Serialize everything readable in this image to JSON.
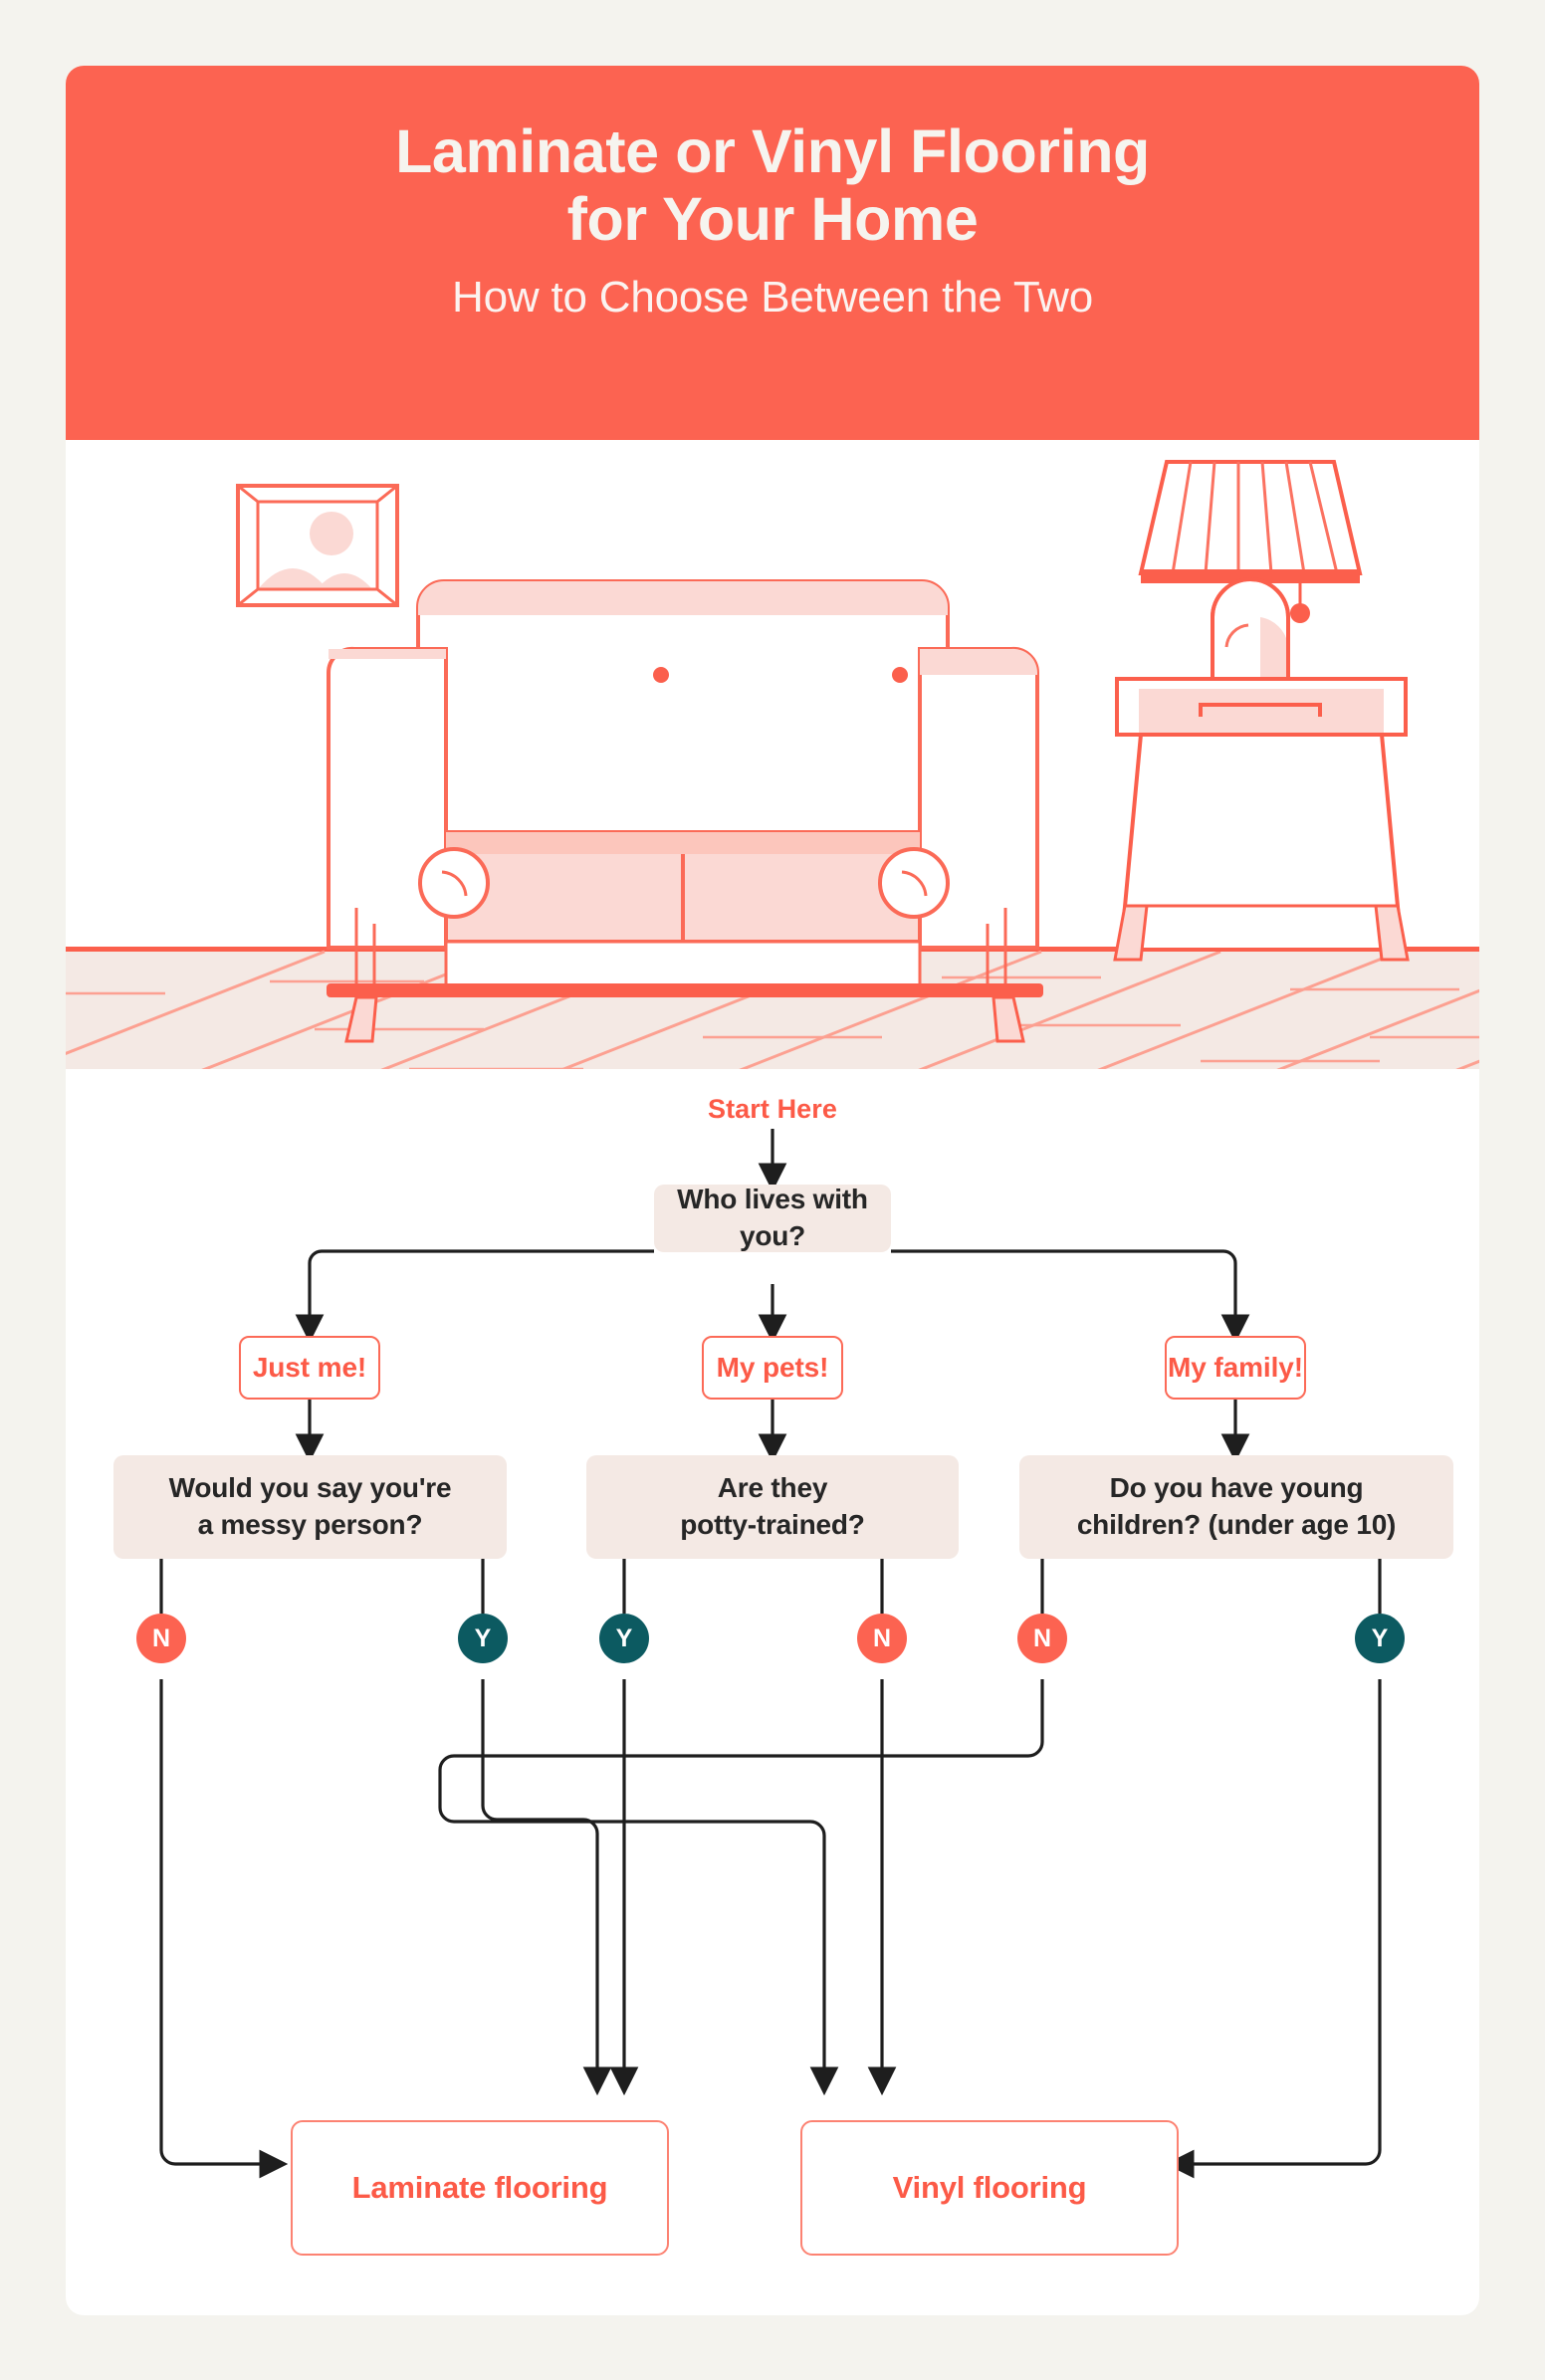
{
  "theme": {
    "page_bg": "#F4F3EE",
    "card_bg": "#FFFFFF",
    "accent_coral": "#FC6351",
    "accent_coral_text": "#FC5A47",
    "box_pink": "#F4E9E4",
    "teal": "#0C5A61",
    "illustration_line": "#FB7261",
    "illustration_fill": "#FBD9D4",
    "floor_bg": "#F4E9E4",
    "wire": "#1E1E1E"
  },
  "header": {
    "title": "Laminate or Vinyl Flooring\nfor Your Home",
    "subtitle": "How to Choose Between the Two"
  },
  "illustration": {
    "name": "living-room-scene",
    "elements": [
      "picture-frame",
      "sofa",
      "table-lamp",
      "side-table",
      "wood-floor"
    ]
  },
  "flowchart": {
    "start_label": "Start Here",
    "root_question": "Who lives with you?",
    "answers": [
      {
        "label": "Just me!"
      },
      {
        "label": "My pets!"
      },
      {
        "label": "My family!"
      }
    ],
    "questions": [
      {
        "label": "Would you say you're\na messy person?"
      },
      {
        "label": "Are they\npotty-trained?"
      },
      {
        "label": "Do you have young\nchildren? (under age 10)"
      }
    ],
    "decisions": [
      {
        "label": "N",
        "kind": "no"
      },
      {
        "label": "Y",
        "kind": "yes"
      },
      {
        "label": "Y",
        "kind": "yes"
      },
      {
        "label": "N",
        "kind": "no"
      },
      {
        "label": "N",
        "kind": "no"
      },
      {
        "label": "Y",
        "kind": "yes"
      }
    ],
    "results": [
      {
        "label": "Laminate flooring"
      },
      {
        "label": "Vinyl flooring"
      }
    ]
  }
}
